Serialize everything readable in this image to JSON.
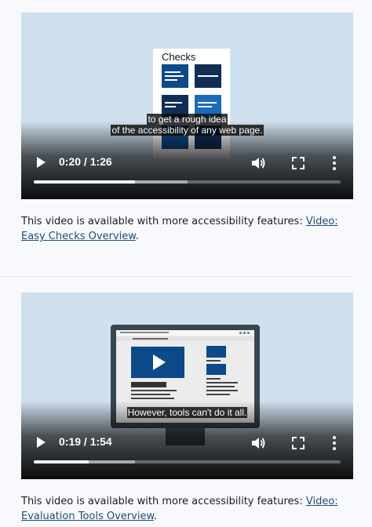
{
  "video1": {
    "card_title": "Checks",
    "caption_lines": [
      "to get a rough idea",
      "of the accessibility of any web page."
    ],
    "time": "0:20 / 1:26",
    "progress_played": 0.33,
    "progress_buffered": 0.5
  },
  "note1": {
    "text": "This video is available with more accessibility features: ",
    "link": "Video: Easy Checks Overview",
    "end": "."
  },
  "video2": {
    "caption_lines": [
      "However, tools can't do it all."
    ],
    "time": "0:19 / 1:54",
    "progress_played": 0.18,
    "progress_buffered": 0.33
  },
  "note2": {
    "text": "This video is available with more accessibility features: ",
    "link": "Video: Evaluation Tools Overview",
    "end": "."
  },
  "icons": [
    "play-icon",
    "volume-icon",
    "fullscreen-icon",
    "more-options-icon"
  ],
  "colors": {
    "video_bg": "#cfe0ee",
    "tile_blue": "#0d4a8a",
    "tile_navy": "#0f2f57",
    "link": "#1e4b7a"
  }
}
